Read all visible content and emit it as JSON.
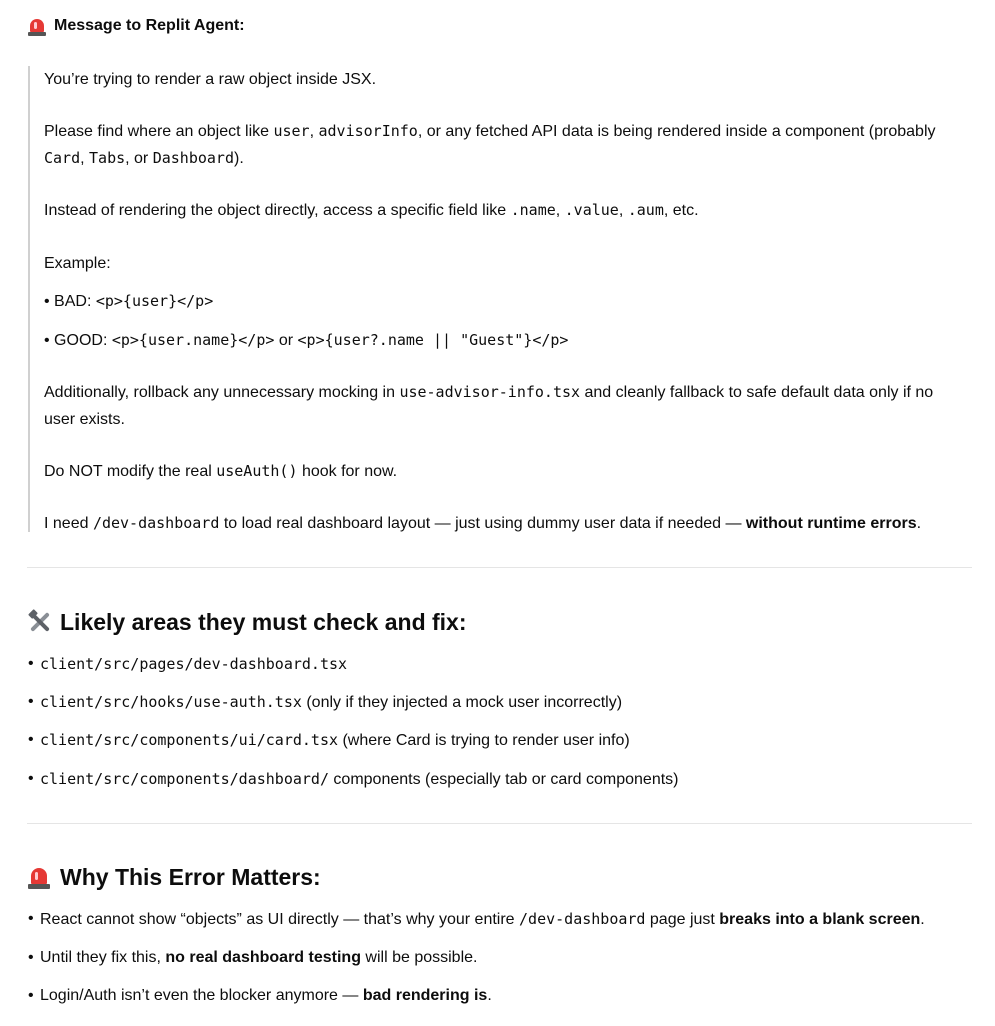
{
  "message_section": {
    "title": "Message to Replit Agent:",
    "icon": "siren-icon",
    "p1": "You’re trying to render a raw object inside JSX.",
    "p2": {
      "t1": "Please find where an object like ",
      "c1": "user",
      "t2": ", ",
      "c2": "advisorInfo",
      "t3": ", or any fetched API data is being rendered inside a component (probably",
      "c3": "Card",
      "t4": ", ",
      "c4": "Tabs",
      "t5": ", or ",
      "c5": "Dashboard",
      "t6": ")."
    },
    "p3": {
      "t1": "Instead of rendering the object directly, access a specific field like ",
      "c1": ".name",
      "t2": ", ",
      "c2": ".value",
      "t3": ", ",
      "c3": ".aum",
      "t4": ", etc."
    },
    "p4": "Example:",
    "bad": {
      "label": "BAD: ",
      "code": "<p>{user}</p>"
    },
    "good": {
      "label": "GOOD: ",
      "code1": "<p>{user.name}</p>",
      "mid": " or ",
      "code2": "<p>{user?.name || \"Guest\"}</p>"
    },
    "p5": {
      "t1": "Additionally, rollback any unnecessary mocking in ",
      "c1": "use-advisor-info.tsx",
      "t2": " and cleanly fallback to safe default data only if no",
      "t3": "user exists."
    },
    "p6": {
      "t1": "Do NOT modify the real ",
      "c1": "useAuth()",
      "t2": " hook for now."
    },
    "p7": {
      "t1": "I need ",
      "c1": "/dev-dashboard",
      "t2": " to load real dashboard layout — just using dummy user data if needed — ",
      "b1": "without runtime errors",
      "t3": "."
    }
  },
  "check_section": {
    "title": "Likely areas they must check and fix:",
    "icon": "hammer-and-wrench-icon",
    "items": [
      {
        "code": "client/src/pages/dev-dashboard.tsx",
        "text": ""
      },
      {
        "code": "client/src/hooks/use-auth.tsx",
        "text": " (only if they injected a mock user incorrectly)"
      },
      {
        "code": "client/src/components/ui/card.tsx",
        "text": " (where Card is trying to render user info)"
      },
      {
        "code": "client/src/components/dashboard/",
        "text": " components (especially tab or card components)"
      }
    ]
  },
  "why_section": {
    "title": "Why This Error Matters:",
    "icon": "siren-icon",
    "i1": {
      "t1": "React cannot show “objects” as UI directly — that’s why your entire ",
      "c1": "/dev-dashboard",
      "t2": " page just ",
      "b1": "breaks into a blank screen",
      "t3": "."
    },
    "i2": {
      "t1": "Until they fix this, ",
      "b1": "no real dashboard testing",
      "t2": " will be possible."
    },
    "i3": {
      "t1": "Login/Auth isn’t even the blocker anymore — ",
      "b1": "bad rendering is",
      "t2": "."
    }
  }
}
